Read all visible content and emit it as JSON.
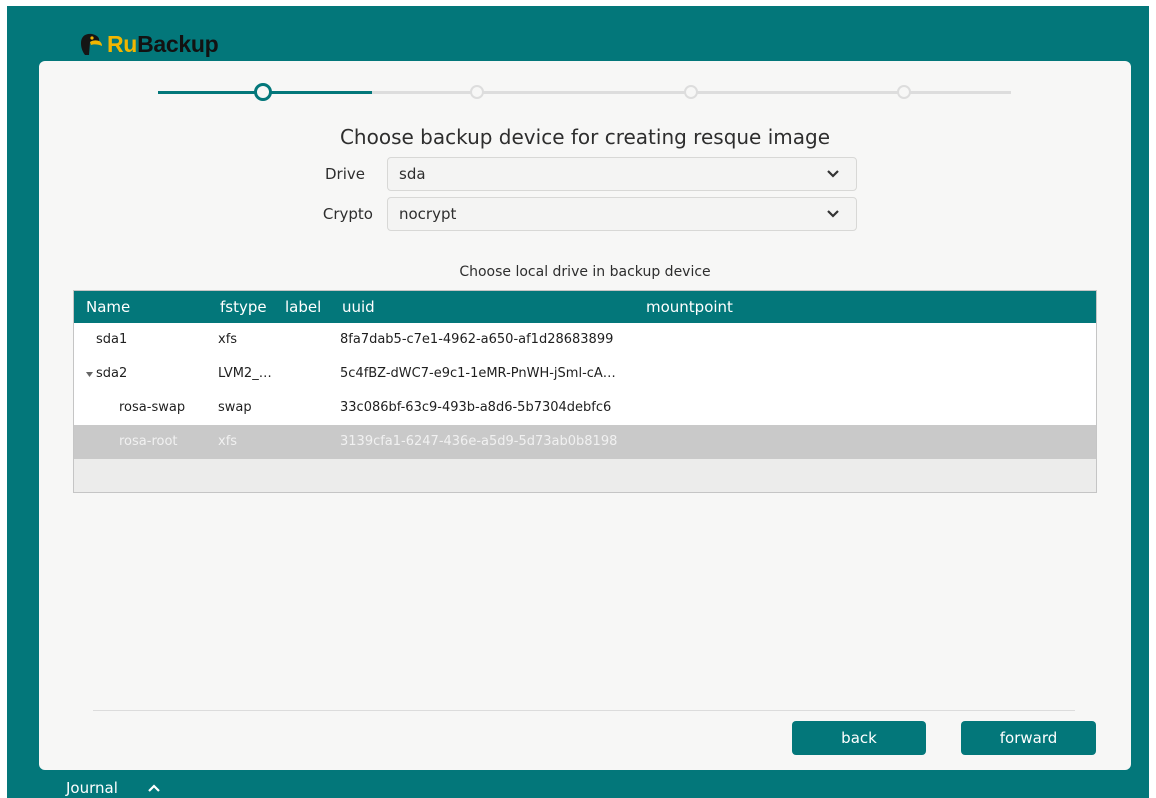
{
  "app": {
    "logo_ru": "Ru",
    "logo_backup": "Backup",
    "brand_color": "#03777a"
  },
  "stepper": {
    "total_steps": 4,
    "current_step": 1
  },
  "page": {
    "title": "Choose backup device for creating resque image",
    "drive_label": "Drive",
    "drive_value": "sda",
    "crypto_label": "Crypto",
    "crypto_value": "nocrypt",
    "subtitle": "Choose local drive in backup device"
  },
  "table": {
    "columns": [
      "Name",
      "fstype",
      "label",
      "uuid",
      "mountpoint"
    ],
    "rows": [
      {
        "name": "sda1",
        "fstype": "xfs",
        "label": "",
        "uuid": "8fa7dab5-c7e1-4962-a650-af1d28683899",
        "mountpoint": ""
      },
      {
        "name": "sda2",
        "fstype": "LVM2_…",
        "label": "",
        "uuid": "5c4fBZ-dWC7-e9c1-1eMR-PnWH-jSml-cA…",
        "mountpoint": "",
        "expanded": true
      },
      {
        "name": "rosa-swap",
        "fstype": "swap",
        "label": "",
        "uuid": "33c086bf-63c9-493b-a8d6-5b7304debfc6",
        "mountpoint": ""
      },
      {
        "name": "rosa-root",
        "fstype": "xfs",
        "label": "",
        "uuid": "3139cfa1-6247-436e-a5d9-5d73ab0b8198",
        "mountpoint": "",
        "selected": true
      }
    ]
  },
  "buttons": {
    "back": "back",
    "forward": "forward"
  },
  "footer": {
    "journal": "Journal"
  }
}
